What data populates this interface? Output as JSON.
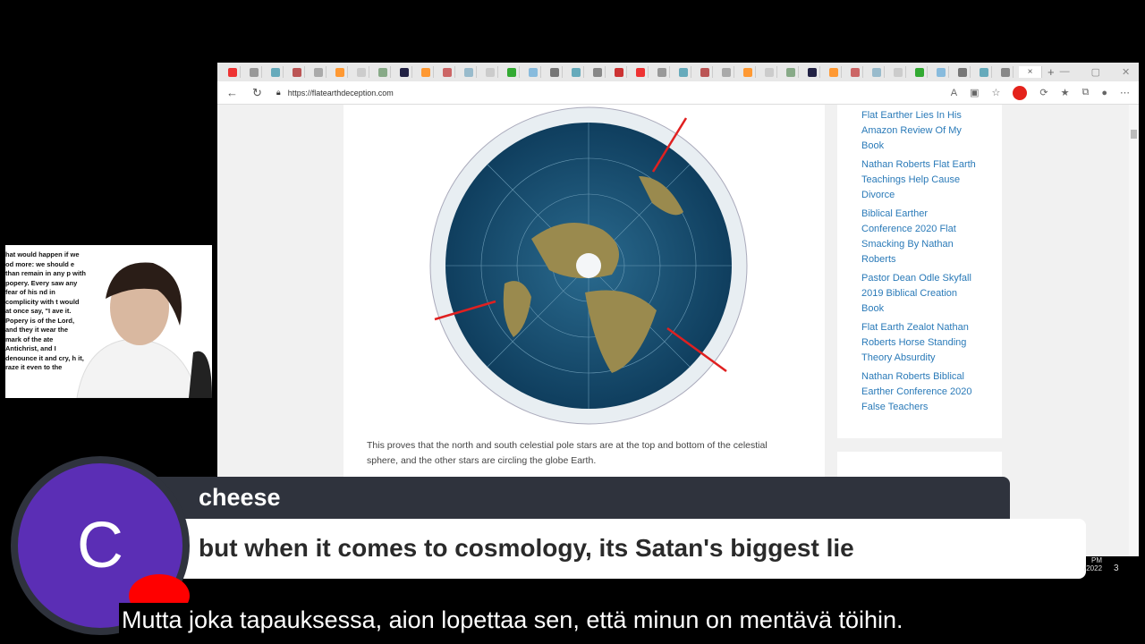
{
  "browser": {
    "url": "https://flatearthdeception.com",
    "tab_count": 37,
    "new_tab": "+",
    "close_tab": "×"
  },
  "article": {
    "caption": "This proves that the north and south celestial pole stars are at the top and bottom of the celestial sphere, and the other stars are circling the globe Earth."
  },
  "sidebar": {
    "links": [
      "Flat Earther Lies In His Amazon Review Of My Book",
      "Nathan Roberts Flat Earth Teachings Help Cause Divorce",
      "Biblical Earther Conference 2020 Flat Smacking By Nathan Roberts",
      "Pastor Dean Odle Skyfall 2019 Biblical Creation Book",
      "Flat Earth Zealot Nathan Roberts Horse Standing Theory Absurdity",
      "Nathan Roberts Biblical Earther Conference 2020 False Teachers"
    ]
  },
  "webcam": {
    "doc_text": "hat would happen if we od more: we should e than remain in any p with popery. Every saw any fear of his nd in complicity with t would at once say, \"I ave it. Popery is of the Lord, and they it wear the mark of the ate Antichrist, and I denounce it and cry, h it, raze it even to the"
  },
  "chat": {
    "username": "cheese",
    "avatar_letter": "C",
    "message": "but when it comes to cosmology, its Satan's biggest lie",
    "accent": "#5b2eb5"
  },
  "subtitle": "Mutta joka tapauksessa, aion lopettaa sen, että minun on mentävä töihin.",
  "taskbar": {
    "time": "PM",
    "date": "/2022",
    "notifications": "3"
  }
}
